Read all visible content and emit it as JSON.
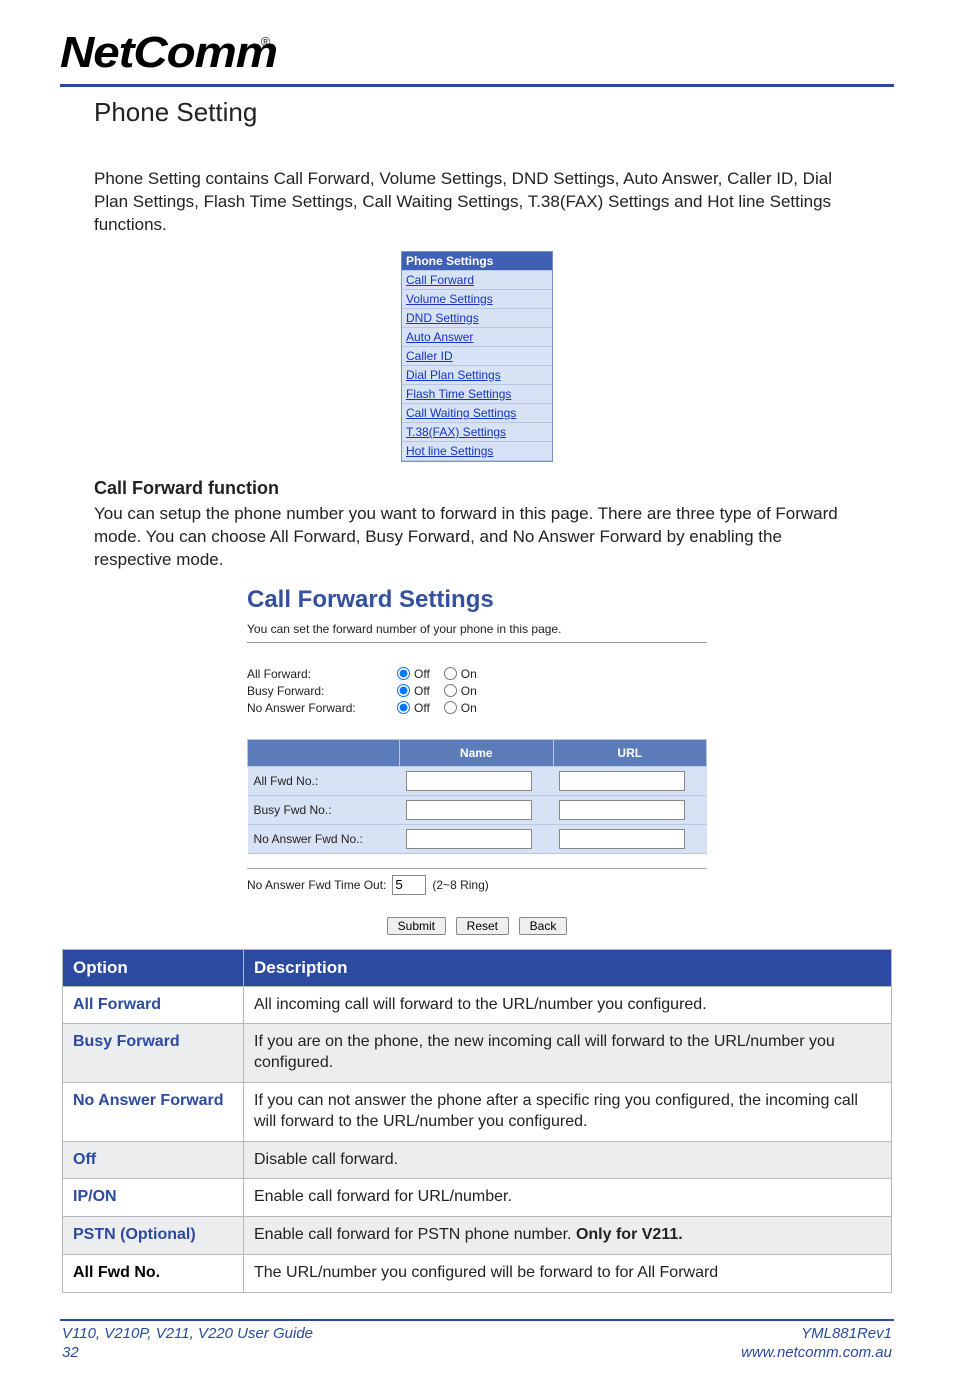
{
  "brand": {
    "name": "NetComm",
    "reg": "®"
  },
  "h1": "Phone Setting",
  "intro": "Phone Setting contains Call Forward, Volume Settings, DND Settings, Auto Answer, Caller ID, Dial Plan Settings, Flash Time Settings, Call Waiting Settings, T.38(FAX) Settings and Hot line Settings functions.",
  "menu": {
    "header": "Phone Settings",
    "items": [
      "Call Forward",
      "Volume Settings",
      "DND Settings",
      "Auto Answer",
      "Caller ID",
      "Dial Plan Settings",
      "Flash Time Settings",
      "Call Waiting Settings",
      "T.38(FAX) Settings",
      "Hot line Settings"
    ]
  },
  "h2": "Call Forward function",
  "cf_intro": "You can setup the phone number you want to forward in this page. There are three type of Forward mode. You can choose All Forward, Busy Forward, and No Answer Forward by enabling the respective mode.",
  "cf_panel": {
    "title": "Call Forward Settings",
    "sub": "You can set the forward number of your phone in this page.",
    "radios": [
      {
        "label": "All Forward:",
        "off": "Off",
        "on": "On",
        "selected": "off"
      },
      {
        "label": "Busy Forward:",
        "off": "Off",
        "on": "On",
        "selected": "off"
      },
      {
        "label": "No Answer Forward:",
        "off": "Off",
        "on": "On",
        "selected": "off"
      }
    ],
    "table": {
      "head_name": "Name",
      "head_url": "URL",
      "rows": [
        {
          "label": "All Fwd No.:",
          "name": "",
          "url": ""
        },
        {
          "label": "Busy Fwd No.:",
          "name": "",
          "url": ""
        },
        {
          "label": "No Answer Fwd No.:",
          "name": "",
          "url": ""
        }
      ]
    },
    "timeout_label": "No Answer Fwd Time Out:",
    "timeout_value": "5",
    "timeout_hint": "(2~8 Ring)",
    "btn_submit": "Submit",
    "btn_reset": "Reset",
    "btn_back": "Back"
  },
  "opt_table": {
    "head_option": "Option",
    "head_desc": "Description",
    "rows": [
      {
        "opt": "All Forward",
        "desc": "All incoming call will forward to the URL/number you configured.",
        "alt": false,
        "black": false
      },
      {
        "opt": "Busy Forward",
        "desc": "If you are on the phone, the new incoming call will forward to the URL/number you configured.",
        "alt": true,
        "black": false
      },
      {
        "opt": "No Answer Forward",
        "desc": "If you can not answer the phone after a specific ring you configured, the incoming call will forward to the URL/number you configured.",
        "alt": false,
        "black": false
      },
      {
        "opt": "Off",
        "desc": "Disable call forward.",
        "alt": true,
        "black": false
      },
      {
        "opt": "IP/ON",
        "desc": "Enable call forward for URL/number.",
        "alt": false,
        "black": false
      },
      {
        "opt": "PSTN (Optional)",
        "desc": "Enable call forward for PSTN phone number. ",
        "desc_bold": "Only for V211.",
        "alt": true,
        "black": false
      },
      {
        "opt": "All Fwd No.",
        "desc": "The URL/number you configured will be forward to for All Forward",
        "alt": false,
        "black": true
      }
    ]
  },
  "footer": {
    "left1": "V110, V210P, V211, V220 User Guide",
    "left2": "32",
    "right1": "YML881Rev1",
    "right2": "www.netcomm.com.au"
  }
}
